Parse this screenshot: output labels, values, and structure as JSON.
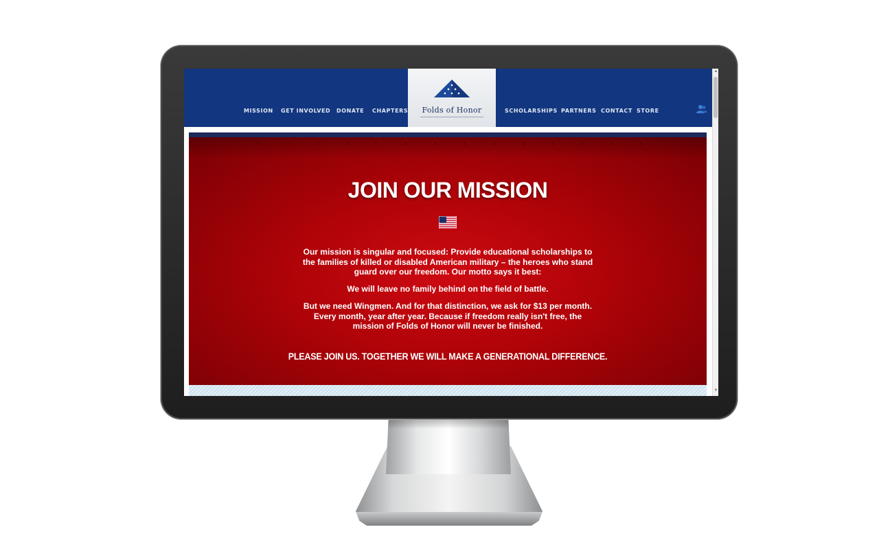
{
  "nav": {
    "left_items": [
      "MISSION",
      "GET INVOLVED",
      "DONATE",
      "CHAPTERS"
    ],
    "right_items": [
      "SCHOLARSHIPS",
      "PARTNERS",
      "CONTACT",
      "STORE"
    ],
    "logo_text": "Folds of Honor",
    "user_icon": "user-group-icon"
  },
  "hero": {
    "title": "JOIN OUR MISSION",
    "flag_icon": "us-flag-icon",
    "paragraph_1": "Our mission is singular and focused: Provide educational scholarships to the families of killed or disabled American military – the heroes who stand guard over our freedom. Our motto says it best:",
    "paragraph_2": "We will leave no family behind on the field of battle.",
    "paragraph_3": "But we need Wingmen. And for that distinction, we ask for $13 per month. Every month, year after year. Because if freedom really isn't free, the mission of Folds of Honor will never be finished.",
    "cta": "PLEASE JOIN US. TOGETHER WE WILL MAKE A GENERATIONAL DIFFERENCE."
  },
  "colors": {
    "nav_blue": "#12367f",
    "hero_red": "#b00308",
    "hero_border": "#1d2a5c"
  }
}
